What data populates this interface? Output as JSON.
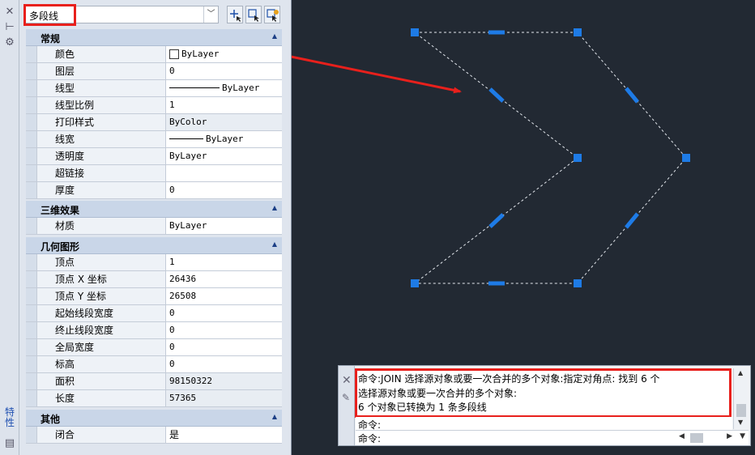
{
  "palette": {
    "side_title": "特性",
    "selected_type": "多段线",
    "toolbar": {
      "quick_select_icon": "quick-select-icon",
      "select_objects_icon": "select-objects-icon",
      "toggle_pickadd_icon": "toggle-pickadd-icon"
    },
    "categories": {
      "general": {
        "title": "常规",
        "rows": [
          {
            "name": "颜色",
            "value": "ByLayer"
          },
          {
            "name": "图层",
            "value": "0"
          },
          {
            "name": "线型",
            "value": "ByLayer"
          },
          {
            "name": "线型比例",
            "value": "1"
          },
          {
            "name": "打印样式",
            "value": "ByColor"
          },
          {
            "name": "线宽",
            "value": "ByLayer"
          },
          {
            "name": "透明度",
            "value": "ByLayer"
          },
          {
            "name": "超链接",
            "value": ""
          },
          {
            "name": "厚度",
            "value": "0"
          }
        ]
      },
      "threed": {
        "title": "三维效果",
        "rows": [
          {
            "name": "材质",
            "value": "ByLayer"
          }
        ]
      },
      "geometry": {
        "title": "几何图形",
        "rows": [
          {
            "name": "顶点",
            "value": "1"
          },
          {
            "name": "顶点 X 坐标",
            "value": "26436"
          },
          {
            "name": "顶点 Y 坐标",
            "value": "26508"
          },
          {
            "name": "起始线段宽度",
            "value": "0"
          },
          {
            "name": "终止线段宽度",
            "value": "0"
          },
          {
            "name": "全局宽度",
            "value": "0"
          },
          {
            "name": "标高",
            "value": "0"
          },
          {
            "name": "面积",
            "value": "98150322"
          },
          {
            "name": "长度",
            "value": "57365"
          }
        ]
      },
      "misc": {
        "title": "其他",
        "rows": [
          {
            "name": "闭合",
            "value": "是"
          }
        ]
      }
    }
  },
  "command": {
    "history": [
      "命令:JOIN 选择源对象或要一次合并的多个对象:指定对角点: 找到 6 个",
      "选择源对象或要一次合并的多个对象:",
      "6 个对象已转换为 1 条多段线"
    ],
    "prompt1": "命令:",
    "prompt2": "命令:"
  },
  "colors": {
    "canvas_bg": "#222933",
    "grip": "#1e7be6",
    "annotation": "#e8201c"
  }
}
